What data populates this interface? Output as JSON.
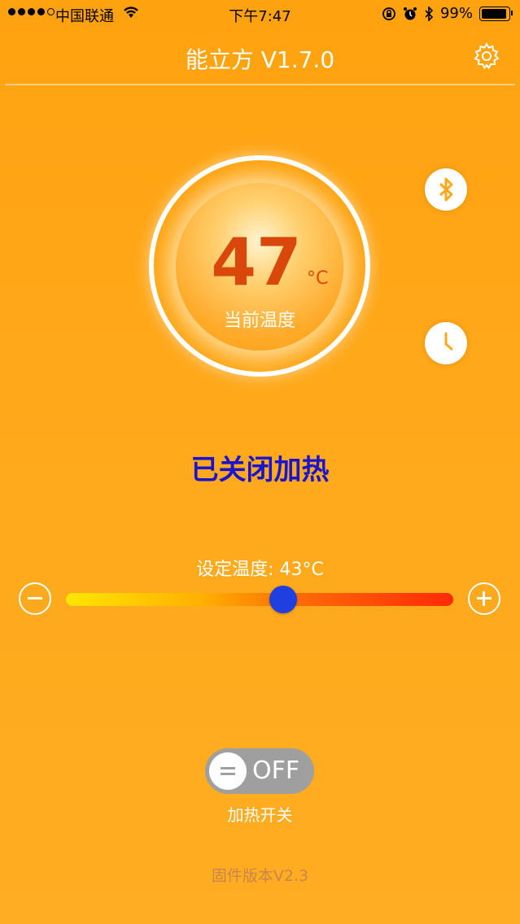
{
  "status_bar": {
    "carrier": "中国联通",
    "time": "下午7:47",
    "battery_percent": "99%"
  },
  "header": {
    "title": "能立方 V1.7.0"
  },
  "gauge": {
    "current_temp": "47",
    "unit": "°C",
    "label": "当前温度"
  },
  "heating_status": "已关闭加热",
  "slider": {
    "label": "设定温度: 43°C",
    "position_fraction": 0.56
  },
  "heat_switch": {
    "state_text": "OFF",
    "label": "加热开关"
  },
  "firmware": "固件版本V2.3",
  "colors": {
    "background": "#ffa81a",
    "temp_value": "#d9470a",
    "heat_status": "#1a14d0",
    "slider_thumb": "#1f3fe0",
    "toggle_off": "#9f9f9f"
  }
}
